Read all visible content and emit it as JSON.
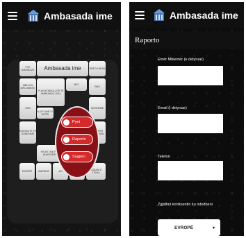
{
  "app": {
    "title": "Ambasada ime"
  },
  "left": {
    "header_tile": "Ambasada ime",
    "tiles": [
      {
        "id": "pyetje",
        "label": "PYE NJERËZVE"
      },
      {
        "id": "rreth",
        "label": "RRETH NESH"
      },
      {
        "id": "sms",
        "label": "SMS"
      },
      {
        "id": "diaspora",
        "label": "MBLLUN DIPLOMATIK"
      },
      {
        "id": "plan",
        "label": "PLAN KONSULLOR TE AMBASADA JUAJ"
      },
      {
        "id": "mpj",
        "label": "MPJ"
      },
      {
        "id": "udhe",
        "label": "UDHËZIME"
      },
      {
        "id": "sos",
        "label": "SOS"
      },
      {
        "id": "kontakt",
        "label": "KONTAKTE TË DOBISHME"
      },
      {
        "id": "njoftime",
        "label": "NJOFTIMET E DITËS"
      },
      {
        "id": "rrjeti",
        "label": "RRJETI ME PËR DIASPORËN"
      },
      {
        "id": "projekte",
        "label": "PROJEKTE PËR FËMIJËT"
      },
      {
        "id": "info",
        "label": "INFO PËR UDHËTIMIN"
      },
      {
        "id": "evrope",
        "label": "EVROPË"
      },
      {
        "id": "amerike",
        "label": "AMERIKË"
      },
      {
        "id": "azi",
        "label": "AZI"
      },
      {
        "id": "afrike",
        "label": "AFRIKË"
      },
      {
        "id": "oqeani",
        "label": "OQEANI E TJERA"
      }
    ],
    "circle_buttons": [
      {
        "label": "Pyet",
        "icon": "question-icon"
      },
      {
        "label": "Raporto",
        "icon": "warning-icon"
      },
      {
        "label": "Sugjero",
        "icon": "check-icon"
      }
    ]
  },
  "right": {
    "section_title": "Raporto",
    "fields": [
      {
        "label": "Emër Mbiemër (e detyruar)",
        "value": ""
      },
      {
        "label": "Email (i detyruar)",
        "value": ""
      },
      {
        "label": "Telefon",
        "value": ""
      }
    ],
    "continent_label": "Zgjidhni kontinentin ku ndodheni",
    "continent_value": "EVROPË"
  },
  "colors": {
    "accent_red": "#d32a2a",
    "background": "#141414"
  }
}
